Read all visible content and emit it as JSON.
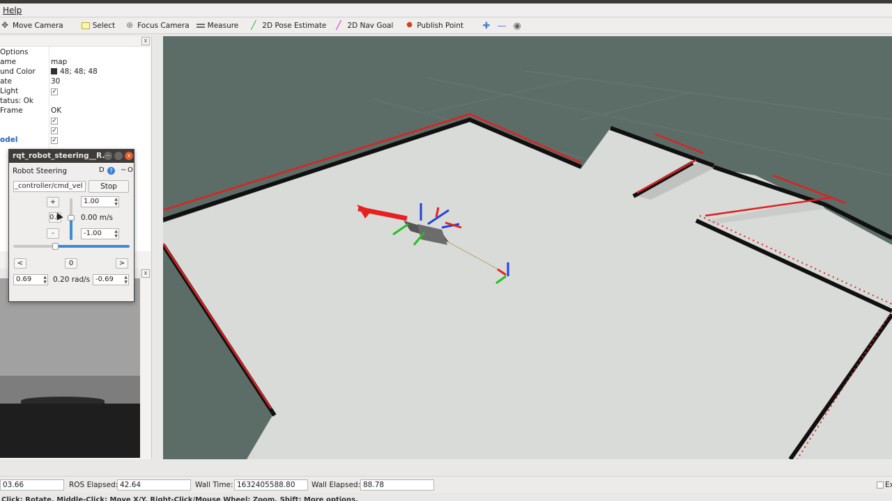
{
  "menu": {
    "help": "Help"
  },
  "toolbar": {
    "move_camera": "Move Camera",
    "select": "Select",
    "focus_camera": "Focus Camera",
    "measure": "Measure",
    "pose_estimate": "2D Pose Estimate",
    "nav_goal": "2D Nav Goal",
    "publish_point": "Publish Point",
    "extra_icons": [
      "✚",
      "—",
      "◉"
    ]
  },
  "displays": {
    "rows": [
      {
        "key": "Options",
        "value": ""
      },
      {
        "key": "ame",
        "value": "map"
      },
      {
        "key": "und Color",
        "value": "48; 48; 48"
      },
      {
        "key": "ate",
        "value": "30"
      },
      {
        "key": "Light",
        "value": "✓"
      },
      {
        "key": "tatus: Ok",
        "value": ""
      },
      {
        "key": "Frame",
        "value": "OK"
      },
      {
        "key": "",
        "value": "✓"
      },
      {
        "key": "",
        "value": "✓"
      },
      {
        "key": "odel",
        "value": "✓"
      }
    ],
    "close": "x"
  },
  "rqt": {
    "title": "rqt_robot_steering__R...",
    "plugin_title": "Robot Steering",
    "d_label": "D",
    "o_label": "O",
    "help": "?",
    "min_btn": "−",
    "close_btn": "x",
    "topic": "_controller/cmd_vel",
    "stop": "Stop",
    "plus": "+",
    "minus": "-",
    "zero_linear": "0.0",
    "max_linear": "1.00",
    "min_linear": "-1.00",
    "linear_value": "0.00 m/s",
    "left": "<",
    "right": ">",
    "zero_angular": "0",
    "max_angular": "0.69",
    "min_angular": "-0.69",
    "angular_value": "0.20 rad/s",
    "linear_slider_fraction": 0.5,
    "angular_slider_fraction": 0.39
  },
  "time": {
    "ros_time_value": "03.66",
    "ros_elapsed_label": "ROS Elapsed:",
    "ros_elapsed_value": "42.64",
    "wall_time_label": "Wall Time:",
    "wall_time_value": "1632405588.80",
    "wall_elapsed_label": "Wall Elapsed:",
    "wall_elapsed_value": "88.78",
    "experimental": "Ex"
  },
  "hint": "Click: Rotate. Middle-Click: Move X/Y. Right-Click/Mouse Wheel: Zoom. Shift: More options.",
  "colors": {
    "background_3d": "#5c6d67",
    "map_floor": "#d9dbd8",
    "laser": "#e02020",
    "wall": "#101010"
  }
}
